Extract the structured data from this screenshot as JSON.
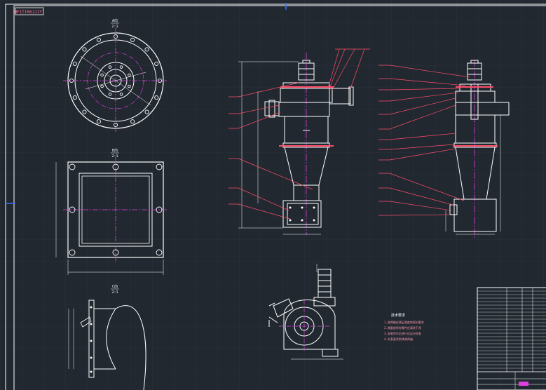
{
  "drawing_code": "HF1T1R6JJ1Y7",
  "views": {
    "a": {
      "label": "A向",
      "scale": "2:1"
    },
    "b": {
      "label": "B向",
      "scale": "2:1"
    },
    "c": {
      "label": "C向",
      "scale": "2:1"
    }
  },
  "tech_requirements": {
    "title": "技术要求",
    "lines": [
      "1.各焊缝应满足强度和密封要求",
      "2.装配前所有零件应清洗干净",
      "3.安装完毕后进行试运行检查",
      "4.外表面涂防锈漆两遍"
    ]
  },
  "colors": {
    "background": "#212830",
    "grid": "#2c3440",
    "outline": "#ffffff",
    "center_line": "#e040e0",
    "callout": "#ff4d6a",
    "frame": "#ffffff",
    "blue_marker": "#3a6cff"
  },
  "titleblock": {
    "rows": 24
  }
}
